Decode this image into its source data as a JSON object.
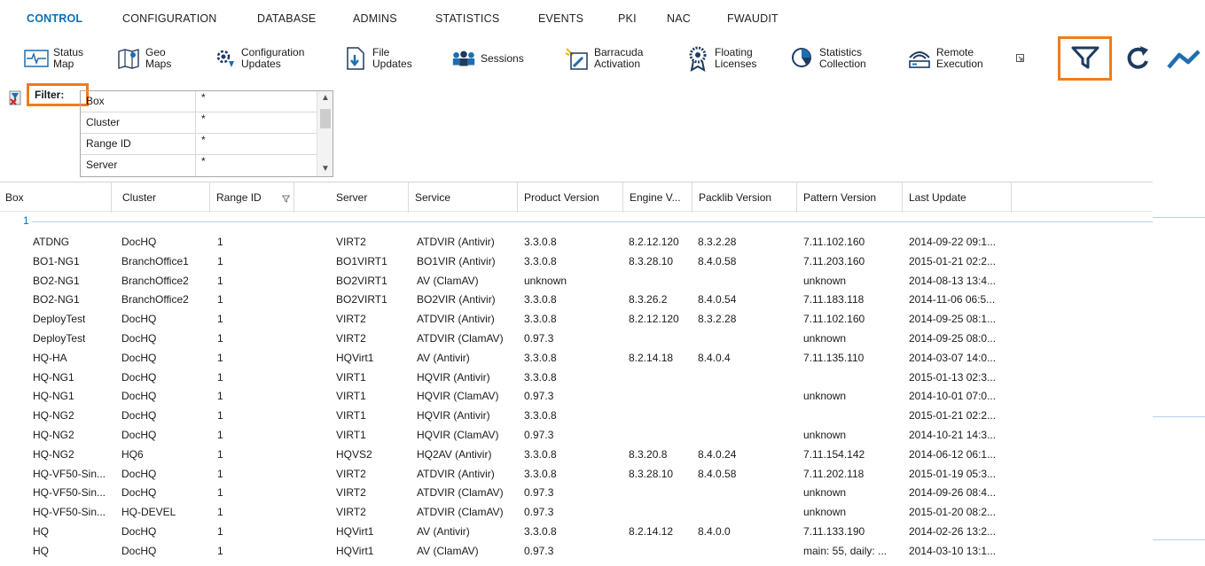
{
  "nav": {
    "tabs": [
      "CONTROL",
      "CONFIGURATION",
      "DATABASE",
      "ADMINS",
      "STATISTICS",
      "EVENTS",
      "PKI",
      "NAC",
      "FWAUDIT"
    ],
    "active": "CONTROL",
    "accent": "#0a6fb8"
  },
  "toolbar": {
    "buttons": [
      {
        "label": "Status\nMap",
        "icon": "status-map-icon"
      },
      {
        "label": "Geo\nMaps",
        "icon": "geo-maps-icon"
      },
      {
        "label": "Configuration\nUpdates",
        "icon": "configuration-updates-icon"
      },
      {
        "label": "File\nUpdates",
        "icon": "file-updates-icon"
      },
      {
        "label": "Sessions",
        "icon": "sessions-icon"
      },
      {
        "label": "Barracuda\nActivation",
        "icon": "barracuda-activation-icon"
      },
      {
        "label": "Floating\nLicenses",
        "icon": "floating-licenses-icon"
      },
      {
        "label": "Statistics\nCollection",
        "icon": "statistics-collection-icon"
      },
      {
        "label": "Remote\nExecution",
        "icon": "remote-execution-icon"
      }
    ],
    "highlight_color": "#f07c1a"
  },
  "filter": {
    "label": "Filter:",
    "rows": [
      {
        "name": "Box",
        "value": "*"
      },
      {
        "name": "Cluster",
        "value": "*"
      },
      {
        "name": "Range ID",
        "value": "*"
      },
      {
        "name": "Server",
        "value": "*"
      }
    ]
  },
  "table": {
    "columns": [
      "Box",
      "Cluster",
      "Range ID",
      "Server",
      "Service",
      "Product Version",
      "Engine V...",
      "Packlib Version",
      "Pattern Version",
      "Last Update"
    ],
    "group_label": "1",
    "rows": [
      [
        "ATDNG",
        "DocHQ",
        "1",
        "VIRT2",
        "ATDVIR (Antivir)",
        "3.3.0.8",
        "8.2.12.120",
        "8.3.2.28",
        "7.11.102.160",
        "2014-09-22 09:1..."
      ],
      [
        "BO1-NG1",
        "BranchOffice1",
        "1",
        "BO1VIRT1",
        "BO1VIR (Antivir)",
        "3.3.0.8",
        "8.3.28.10",
        "8.4.0.58",
        "7.11.203.160",
        "2015-01-21 02:2..."
      ],
      [
        "BO2-NG1",
        "BranchOffice2",
        "1",
        "BO2VIRT1",
        "AV (ClamAV)",
        "unknown",
        "",
        "",
        "unknown",
        "2014-08-13 13:4..."
      ],
      [
        "BO2-NG1",
        "BranchOffice2",
        "1",
        "BO2VIRT1",
        "BO2VIR (Antivir)",
        "3.3.0.8",
        "8.3.26.2",
        "8.4.0.54",
        "7.11.183.118",
        "2014-11-06 06:5..."
      ],
      [
        "DeployTest",
        "DocHQ",
        "1",
        "VIRT2",
        "ATDVIR (Antivir)",
        "3.3.0.8",
        "8.2.12.120",
        "8.3.2.28",
        "7.11.102.160",
        "2014-09-25 08:1..."
      ],
      [
        "DeployTest",
        "DocHQ",
        "1",
        "VIRT2",
        "ATDVIR (ClamAV)",
        "0.97.3",
        "",
        "",
        "unknown",
        "2014-09-25 08:0..."
      ],
      [
        "HQ-HA",
        "DocHQ",
        "1",
        "HQVirt1",
        "AV (Antivir)",
        "3.3.0.8",
        "8.2.14.18",
        "8.4.0.4",
        "7.11.135.110",
        "2014-03-07 14:0..."
      ],
      [
        "HQ-NG1",
        "DocHQ",
        "1",
        "VIRT1",
        "HQVIR (Antivir)",
        "3.3.0.8",
        "",
        "",
        "",
        "2015-01-13 02:3..."
      ],
      [
        "HQ-NG1",
        "DocHQ",
        "1",
        "VIRT1",
        "HQVIR (ClamAV)",
        "0.97.3",
        "",
        "",
        "unknown",
        "2014-10-01 07:0..."
      ],
      [
        "HQ-NG2",
        "DocHQ",
        "1",
        "VIRT1",
        "HQVIR (Antivir)",
        "3.3.0.8",
        "",
        "",
        "",
        "2015-01-21 02:2..."
      ],
      [
        "HQ-NG2",
        "DocHQ",
        "1",
        "VIRT1",
        "HQVIR (ClamAV)",
        "0.97.3",
        "",
        "",
        "unknown",
        "2014-10-21 14:3..."
      ],
      [
        "HQ-NG2",
        "HQ6",
        "1",
        "HQVS2",
        "HQ2AV (Antivir)",
        "3.3.0.8",
        "8.3.20.8",
        "8.4.0.24",
        "7.11.154.142",
        "2014-06-12 06:1..."
      ],
      [
        "HQ-VF50-Sin...",
        "DocHQ",
        "1",
        "VIRT2",
        "ATDVIR (Antivir)",
        "3.3.0.8",
        "8.3.28.10",
        "8.4.0.58",
        "7.11.202.118",
        "2015-01-19 05:3..."
      ],
      [
        "HQ-VF50-Sin...",
        "DocHQ",
        "1",
        "VIRT2",
        "ATDVIR (ClamAV)",
        "0.97.3",
        "",
        "",
        "unknown",
        "2014-09-26 08:4..."
      ],
      [
        "HQ-VF50-Sin...",
        "HQ-DEVEL",
        "1",
        "VIRT2",
        "ATDVIR (ClamAV)",
        "0.97.3",
        "",
        "",
        "unknown",
        "2015-01-20 08:2..."
      ],
      [
        "HQ",
        "DocHQ",
        "1",
        "HQVirt1",
        "AV (Antivir)",
        "3.3.0.8",
        "8.2.14.12",
        "8.4.0.0",
        "7.11.133.190",
        "2014-02-26 13:2..."
      ],
      [
        "HQ",
        "DocHQ",
        "1",
        "HQVirt1",
        "AV (ClamAV)",
        "0.97.3",
        "",
        "",
        "main: 55, daily: ...",
        "2014-03-10 13:1..."
      ]
    ]
  }
}
